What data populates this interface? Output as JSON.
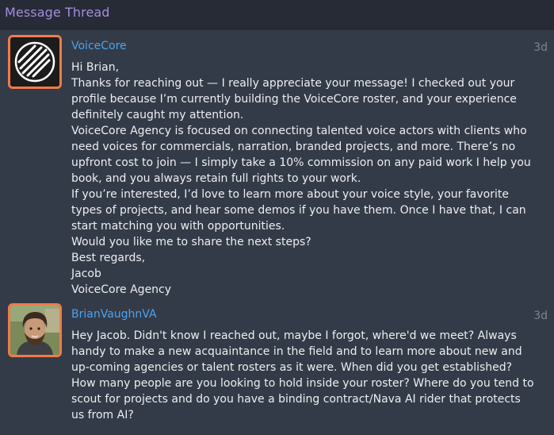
{
  "header": {
    "title": "Message Thread"
  },
  "messages": [
    {
      "sender": "VoiceCore",
      "time": "3d",
      "avatar_icon": "voicecore-logo-icon",
      "lines": [
        "Hi Brian,",
        "Thanks for reaching out — I really appreciate your message! I checked out your",
        "profile because I’m currently building the VoiceCore roster, and your experience",
        "definitely caught my attention.",
        "VoiceCore Agency is focused on connecting talented voice actors with clients who",
        "need voices for commercials, narration, branded projects, and more. There’s no",
        "upfront cost to join — I simply take a 10% commission on any paid work I help you",
        "book, and you always retain full rights to your work.",
        "If you’re interested, I’d love to learn more about your voice style, your favorite",
        "types of projects, and hear some demos if you have them. Once I have that, I can",
        "start matching you with opportunities.",
        "Would you like me to share the next steps?",
        "Best regards,",
        "Jacob",
        "VoiceCore Agency"
      ]
    },
    {
      "sender": "BrianVaughnVA",
      "time": "3d",
      "avatar_icon": "user-photo-avatar",
      "lines": [
        "Hey Jacob. Didn't know I reached out, maybe I forgot, where'd we meet? Always",
        "handy to make a new acquaintance in the field and to learn more about new and",
        "up-coming agencies or talent rosters as it were. When did you get established?",
        "How many people are you looking to hold inside your roster? Where do you tend to",
        "scout for projects and do you have a binding contract/Nava AI rider that protects",
        "us from AI?"
      ]
    }
  ],
  "colors": {
    "accent_title": "#a48ce0",
    "sender_link": "#4aa3ee",
    "avatar_border": "#f07b4a",
    "panel_bg": "#343b48",
    "page_bg": "#262b35"
  }
}
